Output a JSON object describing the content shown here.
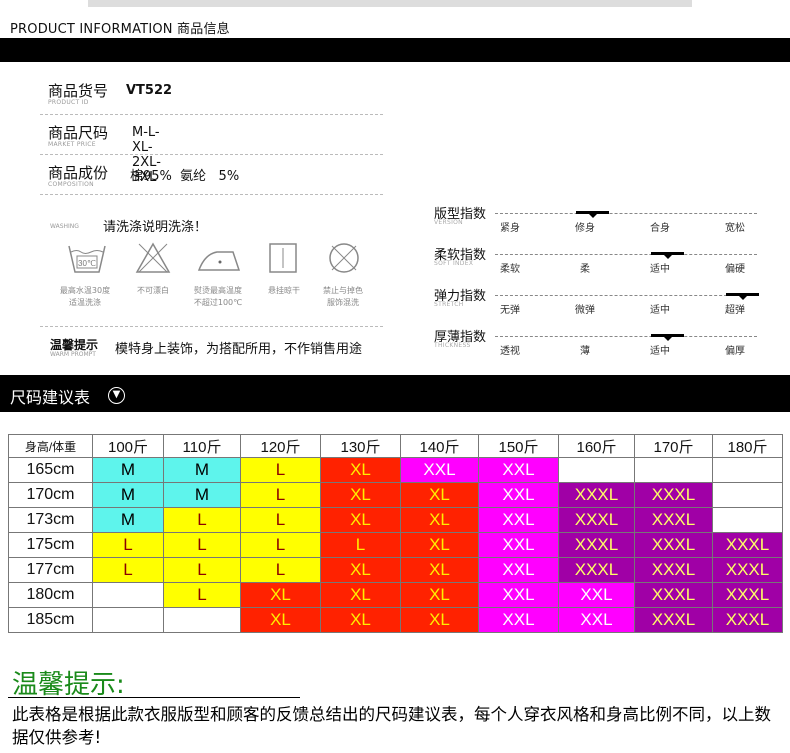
{
  "header": {
    "title": "PRODUCT INFORMATION 商品信息"
  },
  "info": {
    "product_id": {
      "label": "商品货号",
      "sub": "PRODUCT ID",
      "value": "VT522"
    },
    "sizes": {
      "label": "商品尺码",
      "sub": "MARKET PRICE",
      "value": "M-L-XL-2XL-3XL"
    },
    "composition": {
      "label": "商品成份",
      "sub": "COMPOSITION",
      "value": "棉95%  氨纶   5%"
    },
    "washing": {
      "sub": "WASHING",
      "title": "请洗涤说明洗涤！",
      "icons": [
        {
          "icon": "wash-30-icon",
          "text": "30℃",
          "caption": [
            "最高水温30度",
            "适温洗涤"
          ]
        },
        {
          "icon": "no-bleach-icon",
          "caption": [
            "不可漂白"
          ]
        },
        {
          "icon": "iron-icon",
          "caption": [
            "熨烫最高温度",
            "不超过100℃"
          ]
        },
        {
          "icon": "hang-dry-icon",
          "caption": [
            "悬挂晾干"
          ]
        },
        {
          "icon": "no-mixed-wash-icon",
          "caption": [
            "禁止与掉色",
            "服饰混洗"
          ]
        }
      ]
    },
    "warm_prompt": {
      "label": "温馨提示",
      "sub": "WARM PROMPT",
      "value": "模特身上装饰，为搭配所用，不作销售用途"
    }
  },
  "indices": [
    {
      "label": "版型指数",
      "sub": "VERSION",
      "options": [
        "紧身",
        "修身",
        "合身",
        "宽松"
      ],
      "selected": 1
    },
    {
      "label": "柔软指数",
      "sub": "SOFT INDEX",
      "options": [
        "柔软",
        "柔",
        "适中",
        "偏硬"
      ],
      "selected": 2
    },
    {
      "label": "弹力指数",
      "sub": "STRETCH",
      "options": [
        "无弹",
        "微弹",
        "适中",
        "超弹"
      ],
      "selected": 3
    },
    {
      "label": "厚薄指数",
      "sub": "THICKNESS",
      "options": [
        "透视",
        "薄",
        "适中",
        "偏厚"
      ],
      "selected": 2
    }
  ],
  "size_chart": {
    "title": "尺码建议表",
    "icon": "circle-chevron-down-icon",
    "corner": "身高/体重",
    "weights": [
      "100斤",
      "110斤",
      "120斤",
      "130斤",
      "140斤",
      "150斤",
      "160斤",
      "170斤",
      "180斤"
    ],
    "colors": {
      "cyan": "#5ef4ec",
      "yellow": "#ffff00",
      "red": "#ff2200",
      "magenta": "#ff00ff",
      "purple": "#a000a6"
    },
    "rows": [
      {
        "height": "165cm",
        "cells": [
          [
            "M",
            "cyan"
          ],
          [
            "M",
            "cyan"
          ],
          [
            "L",
            "yellow"
          ],
          [
            "XL",
            "red"
          ],
          [
            "XXL",
            "magenta"
          ],
          [
            "XXL",
            "magenta"
          ],
          [
            "",
            ""
          ],
          [
            "",
            ""
          ],
          [
            "",
            ""
          ]
        ]
      },
      {
        "height": "170cm",
        "cells": [
          [
            "M",
            "cyan"
          ],
          [
            "M",
            "cyan"
          ],
          [
            "L",
            "yellow"
          ],
          [
            "XL",
            "red"
          ],
          [
            "XL",
            "red"
          ],
          [
            "XXL",
            "magenta"
          ],
          [
            "XXXL",
            "purple"
          ],
          [
            "XXXL",
            "purple"
          ],
          [
            "",
            ""
          ]
        ]
      },
      {
        "height": "173cm",
        "cells": [
          [
            "M",
            "cyan"
          ],
          [
            "L",
            "yellow"
          ],
          [
            "L",
            "yellow"
          ],
          [
            "XL",
            "red"
          ],
          [
            "XL",
            "red"
          ],
          [
            "XXL",
            "magenta"
          ],
          [
            "XXXL",
            "purple"
          ],
          [
            "XXXL",
            "purple"
          ],
          [
            "",
            ""
          ]
        ]
      },
      {
        "height": "175cm",
        "cells": [
          [
            "L",
            "yellow"
          ],
          [
            "L",
            "yellow"
          ],
          [
            "L",
            "yellow"
          ],
          [
            "L",
            "red"
          ],
          [
            "XL",
            "red"
          ],
          [
            "XXL",
            "magenta"
          ],
          [
            "XXXL",
            "purple"
          ],
          [
            "XXXL",
            "purple"
          ],
          [
            "XXXL",
            "purple"
          ]
        ]
      },
      {
        "height": "177cm",
        "cells": [
          [
            "L",
            "yellow"
          ],
          [
            "L",
            "yellow"
          ],
          [
            "L",
            "yellow"
          ],
          [
            "XL",
            "red"
          ],
          [
            "XL",
            "red"
          ],
          [
            "XXL",
            "magenta"
          ],
          [
            "XXXL",
            "purple"
          ],
          [
            "XXXL",
            "purple"
          ],
          [
            "XXXL",
            "purple"
          ]
        ]
      },
      {
        "height": "180cm",
        "cells": [
          [
            "",
            ""
          ],
          [
            "L",
            "yellow"
          ],
          [
            "XL",
            "red"
          ],
          [
            "XL",
            "red"
          ],
          [
            "XL",
            "red"
          ],
          [
            "XXL",
            "magenta"
          ],
          [
            "XXL",
            "magenta"
          ],
          [
            "XXXL",
            "purple"
          ],
          [
            "XXXL",
            "purple"
          ]
        ]
      },
      {
        "height": "185cm",
        "cells": [
          [
            "",
            ""
          ],
          [
            "",
            ""
          ],
          [
            "XL",
            "red"
          ],
          [
            "XL",
            "red"
          ],
          [
            "XL",
            "red"
          ],
          [
            "XXL",
            "magenta"
          ],
          [
            "XXL",
            "magenta"
          ],
          [
            "XXXL",
            "purple"
          ],
          [
            "XXXL",
            "purple"
          ]
        ]
      }
    ]
  },
  "warm_tip": {
    "title": "温馨提示:",
    "text": "此表格是根据此款衣服版型和顾客的反馈总结出的尺码建议表，每个人穿衣风格和身高比例不同，以上数据仅供参考!"
  }
}
